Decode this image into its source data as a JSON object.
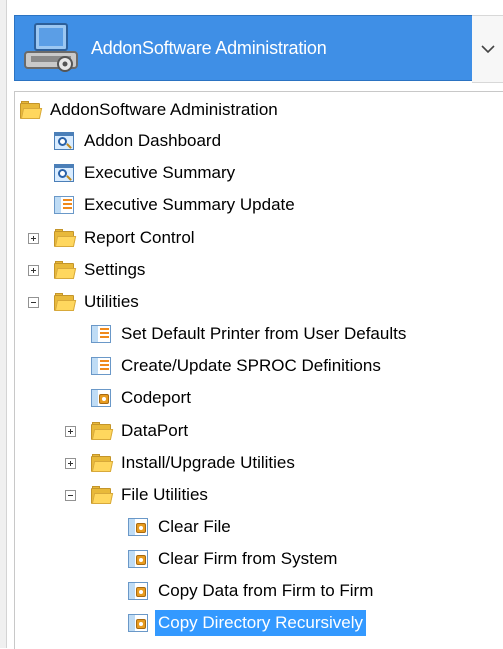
{
  "header": {
    "title": "AddonSoftware Administration",
    "icon": "admin-console-icon",
    "dropdown_icon": "chevron-down-icon",
    "accent": "#3f8fe6"
  },
  "tree": {
    "root": {
      "label": "AddonSoftware Administration",
      "icon": "folder-open-icon",
      "expanded": true
    },
    "items": [
      {
        "label": "Addon Dashboard",
        "icon": "dashboard-icon"
      },
      {
        "label": "Executive Summary",
        "icon": "dashboard-icon"
      },
      {
        "label": "Executive Summary Update",
        "icon": "report-icon"
      },
      {
        "label": "Report Control",
        "icon": "folder-icon",
        "expander": "plus"
      },
      {
        "label": "Settings",
        "icon": "folder-icon",
        "expander": "plus"
      },
      {
        "label": "Utilities",
        "icon": "folder-open-icon",
        "expander": "minus"
      },
      {
        "label": "Set Default Printer from User Defaults",
        "icon": "report-icon"
      },
      {
        "label": "Create/Update SPROC Definitions",
        "icon": "report-icon"
      },
      {
        "label": "Codeport",
        "icon": "utility-icon"
      },
      {
        "label": "DataPort",
        "icon": "folder-icon",
        "expander": "plus"
      },
      {
        "label": "Install/Upgrade Utilities",
        "icon": "folder-icon",
        "expander": "plus"
      },
      {
        "label": "File Utilities",
        "icon": "folder-open-icon",
        "expander": "minus"
      },
      {
        "label": "Clear File",
        "icon": "utility-icon"
      },
      {
        "label": "Clear Firm from System",
        "icon": "utility-icon"
      },
      {
        "label": "Copy Data from Firm to Firm",
        "icon": "utility-icon"
      },
      {
        "label": "Copy Directory Recursively",
        "icon": "utility-icon",
        "selected": true
      }
    ],
    "selection_color": "#3399ff"
  }
}
